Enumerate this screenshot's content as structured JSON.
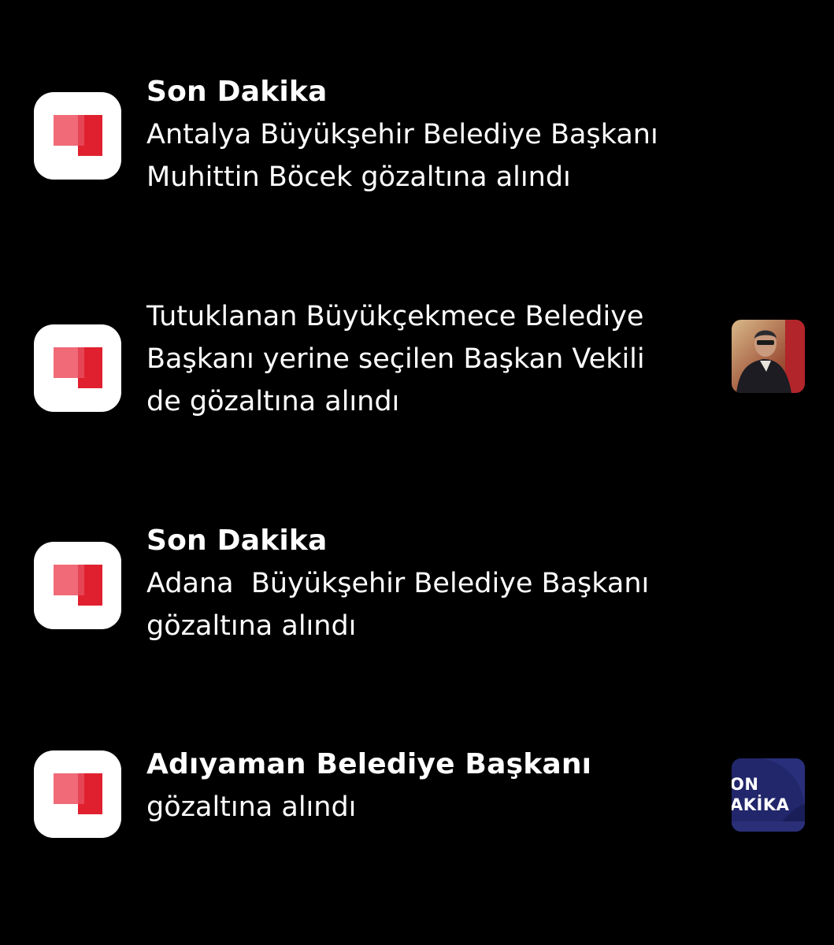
{
  "notifications": [
    {
      "app_icon": "son-dakika-app-icon",
      "title": "Son Dakika",
      "lines": [
        "Antalya Büyükşehir Belediye Başkanı",
        "Muhittin Böcek gözaltına alındı"
      ]
    },
    {
      "app_icon": "son-dakika-app-icon",
      "lines": [
        "Tutuklanan Büyükçekmece Belediye",
        "Başkanı yerine seçilen Başkan Vekili",
        "de gözaltına alındı"
      ],
      "thumbnail": "man-in-suit-photo"
    },
    {
      "app_icon": "son-dakika-app-icon",
      "title": "Son Dakika",
      "lines": [
        "Adana  Büyükşehir Belediye Başkanı",
        "gözaltına alındı"
      ]
    },
    {
      "app_icon": "son-dakika-app-icon",
      "title": "Adıyaman Belediye Başkanı",
      "lines": [
        "gözaltına alındı"
      ],
      "thumbnail": "son-dakika-banner",
      "thumbnail_text": [
        "ON",
        "AKİKA"
      ]
    }
  ],
  "colors": {
    "background": "#000000",
    "text": "#ffffff",
    "logo_dark_red": "#e0202e",
    "logo_light_red": "#f06a78",
    "thumb_navy": "#22266a"
  }
}
